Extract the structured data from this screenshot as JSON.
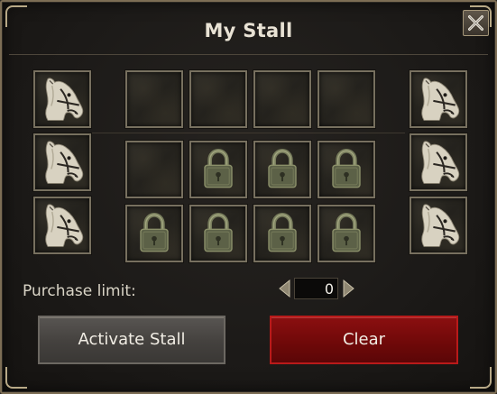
{
  "window": {
    "title": "My Stall",
    "close_icon": "close-x-icon"
  },
  "colors": {
    "frame": "#7d6e55",
    "panel": "#1c1a18",
    "slot_border": "#77705f",
    "horse_icon": "#d6d0bf",
    "lock_icon": "#6f7555",
    "clear_button": "#7a0b0b",
    "activate_button": "#4a4744"
  },
  "mount_slots": {
    "left": [
      "horse-icon",
      "horse-icon",
      "horse-icon"
    ],
    "right": [
      "horse-icon",
      "horse-icon",
      "horse-icon"
    ]
  },
  "stall_slots": [
    [
      "empty",
      "empty",
      "empty",
      "empty"
    ],
    [
      "empty",
      "lock-icon",
      "lock-icon",
      "lock-icon"
    ],
    [
      "lock-icon",
      "lock-icon",
      "lock-icon",
      "lock-icon"
    ]
  ],
  "purchase_limit": {
    "label": "Purchase limit:",
    "value": "0"
  },
  "buttons": {
    "activate_label": "Activate Stall",
    "clear_label": "Clear"
  }
}
